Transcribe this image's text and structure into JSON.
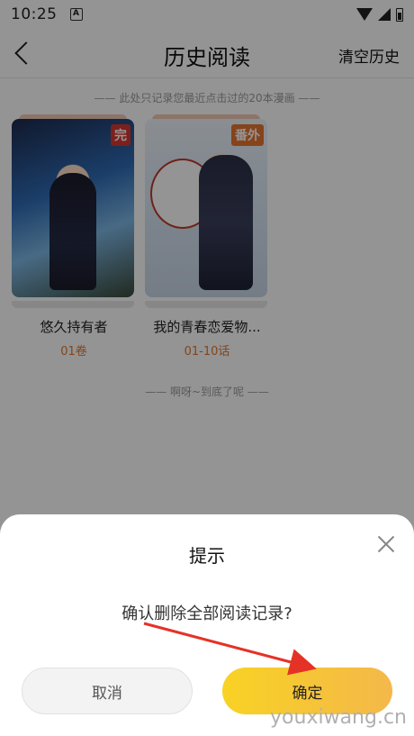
{
  "status_bar": {
    "time": "10:25",
    "notification_letter": "A"
  },
  "header": {
    "title": "历史阅读",
    "clear_label": "清空历史"
  },
  "history": {
    "note": "—— 此处只记录您最近点击过的20本漫画 ——",
    "items": [
      {
        "title": "悠久持有者",
        "progress": "01卷",
        "badge": "完"
      },
      {
        "title": "我的青春恋爱物...",
        "progress": "01-10话",
        "badge": "番外"
      }
    ],
    "end_text": "—— 啊呀~到底了呢 ——"
  },
  "dialog": {
    "title": "提示",
    "message": "确认删除全部阅读记录?",
    "cancel_label": "取消",
    "confirm_label": "确定"
  },
  "watermark": "youxiwang.cn",
  "colors": {
    "accent": "#f8d224",
    "progress": "#e0782b",
    "annotation_arrow": "#e53226"
  }
}
